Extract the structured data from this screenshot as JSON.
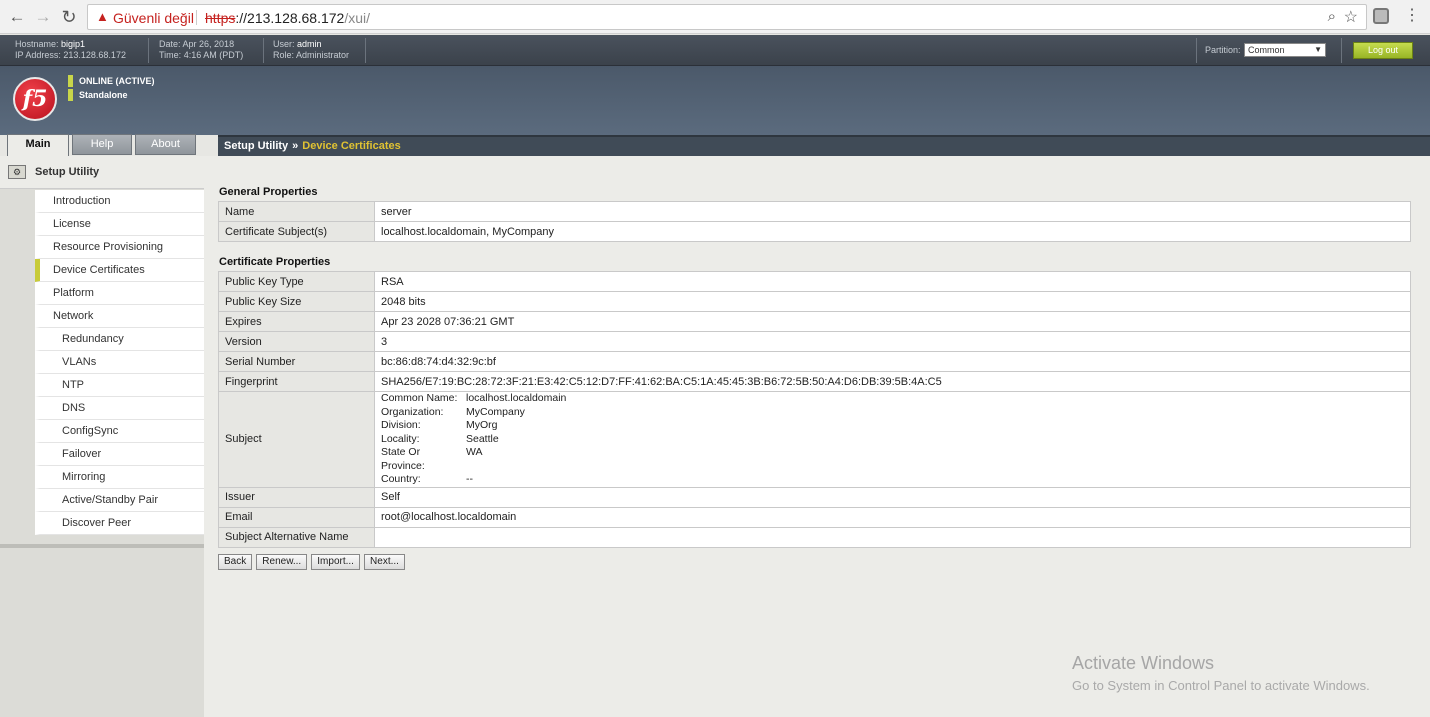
{
  "browser": {
    "back_icon": "←",
    "forward_icon": "→",
    "reload_icon": "↻",
    "warning_icon": "▲",
    "security_label": "Güvenli değil",
    "url_scheme": "https",
    "url_host": "://213.128.68.172",
    "url_path": "/xui/",
    "zoom_icon": "⌕",
    "star_icon": "☆",
    "menu_icon": "⋮"
  },
  "header": {
    "hostname_label": "Hostname:",
    "hostname": "bigip1",
    "ip_label": "IP Address:",
    "ip": "213.128.68.172",
    "date_label": "Date:",
    "date": "Apr 26, 2018",
    "time_label": "Time:",
    "time": "4:16 AM (PDT)",
    "user_label": "User:",
    "user": "admin",
    "role_label": "Role:",
    "role": "Administrator",
    "partition_label": "Partition:",
    "partition_value": "Common",
    "partition_arrow": "▼",
    "logout_label": "Log out",
    "logo_text": "f5",
    "status_online": "ONLINE (ACTIVE)",
    "status_mode": "Standalone"
  },
  "tabs": [
    {
      "label": "Main"
    },
    {
      "label": "Help"
    },
    {
      "label": "About"
    }
  ],
  "breadcrumb": {
    "root": "Setup Utility",
    "separator": "»",
    "current": "Device Certificates"
  },
  "sidebar": {
    "title": "Setup Utility",
    "items": [
      {
        "label": "Introduction"
      },
      {
        "label": "License"
      },
      {
        "label": "Resource Provisioning"
      },
      {
        "label": "Device Certificates"
      },
      {
        "label": "Platform"
      },
      {
        "label": "Network"
      },
      {
        "label": "Redundancy"
      },
      {
        "label": "VLANs"
      },
      {
        "label": "NTP"
      },
      {
        "label": "DNS"
      },
      {
        "label": "ConfigSync"
      },
      {
        "label": "Failover"
      },
      {
        "label": "Mirroring"
      },
      {
        "label": "Active/Standby Pair"
      },
      {
        "label": "Discover Peer"
      }
    ]
  },
  "general": {
    "title": "General Properties",
    "rows": [
      {
        "key": "Name",
        "value": "server"
      },
      {
        "key": "Certificate Subject(s)",
        "value": "localhost.localdomain, MyCompany"
      }
    ]
  },
  "certificate": {
    "title": "Certificate Properties",
    "public_key_type": {
      "key": "Public Key Type",
      "value": "RSA"
    },
    "public_key_size": {
      "key": "Public Key Size",
      "value": "2048 bits"
    },
    "expires": {
      "key": "Expires",
      "value": "Apr 23 2028 07:36:21 GMT"
    },
    "version": {
      "key": "Version",
      "value": "3"
    },
    "serial": {
      "key": "Serial Number",
      "value": "bc:86:d8:74:d4:32:9c:bf"
    },
    "fingerprint": {
      "key": "Fingerprint",
      "value": "SHA256/E7:19:BC:28:72:3F:21:E3:42:C5:12:D7:FF:41:62:BA:C5:1A:45:45:3B:B6:72:5B:50:A4:D6:DB:39:5B:4A:C5"
    },
    "subject": {
      "key": "Subject",
      "common_name_label": "Common Name:",
      "common_name": "localhost.localdomain",
      "organization_label": "Organization:",
      "organization": "MyCompany",
      "division_label": "Division:",
      "division": "MyOrg",
      "locality_label": "Locality:",
      "locality": "Seattle",
      "state_label": "State Or Province:",
      "state": "WA",
      "country_label": "Country:",
      "country": "--"
    },
    "issuer": {
      "key": "Issuer",
      "value": "Self"
    },
    "email": {
      "key": "Email",
      "value": "root@localhost.localdomain"
    },
    "san": {
      "key": "Subject Alternative Name",
      "value": ""
    }
  },
  "buttons": {
    "back": "Back",
    "renew": "Renew...",
    "import": "Import...",
    "next": "Next..."
  },
  "watermark": {
    "title": "Activate Windows",
    "subtitle": "Go to System in Control Panel to activate Windows."
  }
}
